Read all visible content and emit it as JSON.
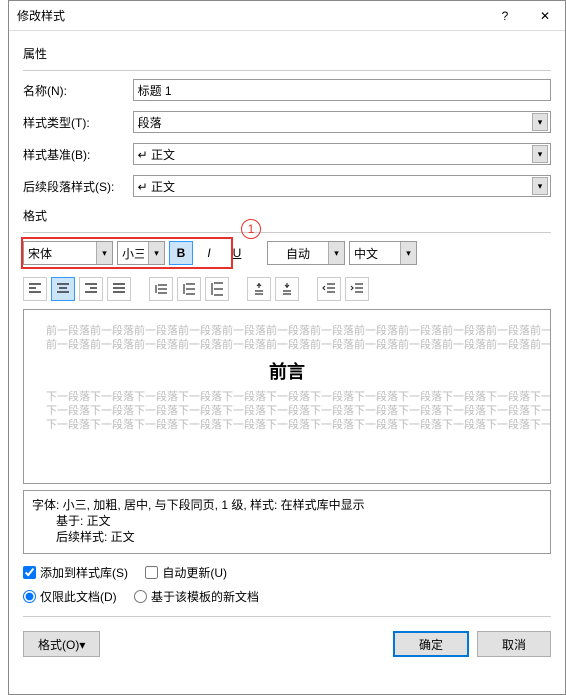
{
  "window": {
    "title": "修改样式",
    "help": "?",
    "close": "✕"
  },
  "properties": {
    "section": "属性",
    "name_label": "名称(N):",
    "name_value": "标题 1",
    "type_label": "样式类型(T):",
    "type_value": "段落",
    "base_label": "样式基准(B):",
    "base_value": "↵ 正文",
    "follow_label": "后续段落样式(S):",
    "follow_value": "↵ 正文"
  },
  "format": {
    "section": "格式",
    "font_name": "宋体",
    "font_size": "小三",
    "bold": "B",
    "italic": "I",
    "underline": "U",
    "color": "自动",
    "script": "中文",
    "annotation": "1"
  },
  "preview": {
    "before": "前一段落前一段落前一段落前一段落前一段落前一段落前一段落前一段落前一段落前一段落前一段落前一段落前一段落前一段落前一段落前一段落",
    "sample": "前言",
    "after1": "下一段落下一段落下一段落下一段落下一段落下一段落下一段落下一段落下一段落下一段落下一段落下一段落下一段落下一段落下一段落下一段落下一段落下一段落下一段落下一段落下一段落下一段落下一段落下一段落下一段落下一段落下一段落"
  },
  "description": {
    "line1": "字体: 小三, 加粗, 居中, 与下段同页, 1 级, 样式: 在样式库中显示",
    "line2": "基于: 正文",
    "line3": "后续样式: 正文"
  },
  "options": {
    "add_gallery": "添加到样式库(S)",
    "auto_update": "自动更新(U)",
    "this_doc": "仅限此文档(D)",
    "template": "基于该模板的新文档"
  },
  "buttons": {
    "format_menu": "格式(O)▾",
    "ok": "确定",
    "cancel": "取消"
  }
}
